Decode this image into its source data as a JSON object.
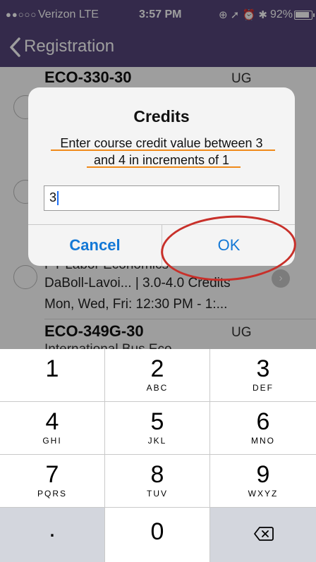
{
  "status_bar": {
    "signal": "●●○○○",
    "carrier": "Verizon  LTE",
    "time": "3:57 PM",
    "icons": "⊕ ➚ ⏰ ✱",
    "battery": "92%",
    "battery_level": 0.92
  },
  "nav": {
    "back_label": "Registration"
  },
  "courses": [
    {
      "code": "ECO-330-30",
      "level": "UG"
    },
    {
      "title_partial": "PT Labor Economics",
      "instructor_line": "DaBoll-Lavoi...  | 3.0-4.0 Credits",
      "schedule": "Mon, Wed, Fri: 12:30 PM - 1:..."
    },
    {
      "code": "ECO-349G-30",
      "level": "UG",
      "title_partial": "International Bus Eco"
    }
  ],
  "alert": {
    "title": "Credits",
    "message_line1": "Enter course credit value between 3",
    "message_line2": "and 4 in increments of 1",
    "input_value": "3",
    "cancel_label": "Cancel",
    "ok_label": "OK"
  },
  "keyboard": {
    "keys": [
      {
        "num": "1",
        "letters": ""
      },
      {
        "num": "2",
        "letters": "ABC"
      },
      {
        "num": "3",
        "letters": "DEF"
      },
      {
        "num": "4",
        "letters": "GHI"
      },
      {
        "num": "5",
        "letters": "JKL"
      },
      {
        "num": "6",
        "letters": "MNO"
      },
      {
        "num": "7",
        "letters": "PQRS"
      },
      {
        "num": "8",
        "letters": "TUV"
      },
      {
        "num": "9",
        "letters": "WXYZ"
      }
    ],
    "dot": ".",
    "zero": "0"
  },
  "colors": {
    "nav_bg": "#54447a",
    "accent": "#1378d6",
    "highlight": "#f08a1a",
    "annotation": "#c8302a"
  }
}
